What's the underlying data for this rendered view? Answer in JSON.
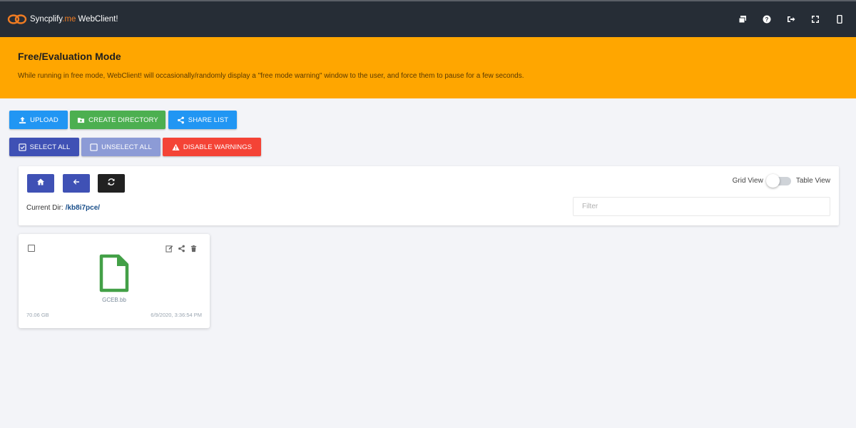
{
  "app": {
    "brand_name": "Syncplify",
    "brand_suffix": ".me",
    "brand_product": " WebClient!",
    "top_icons": [
      "stacked-windows-icon",
      "help-icon",
      "logout-icon",
      "fullscreen-icon",
      "mobile-icon"
    ]
  },
  "banner": {
    "title": "Free/Evaluation Mode",
    "text": "While running in free mode, WebClient! will occasionally/randomly display a \"free mode warning\" window to the user, and force them to pause for a few seconds.",
    "color": "#ffa600"
  },
  "toolbar": {
    "upload_label": "UPLOAD",
    "create_dir_label": "CREATE DIRECTORY",
    "share_list_label": "SHARE LIST",
    "select_all_label": "SELECT ALL",
    "unselect_all_label": "UNSELECT ALL",
    "disable_warnings_label": "DISABLE WARNINGS"
  },
  "colors": {
    "upload": "#2196f3",
    "create_dir": "#4caf50",
    "share": "#2196f3",
    "select_all": "#3f51b5",
    "unselect_all": "#8c9bd6",
    "disable_warnings": "#f44336",
    "home_btn": "#3f51b5",
    "back_btn": "#3f51b5",
    "refresh_btn": "#212121",
    "file_icon": "#43a047"
  },
  "browser": {
    "current_dir_label": "Current Dir:",
    "current_dir": "/kb8i7pce/",
    "grid_view_label": "Grid View",
    "table_view_label": "Table View",
    "view_mode": "grid",
    "filter_placeholder": "Filter"
  },
  "files": [
    {
      "name": "GCEB.bb",
      "size": "70.06 GB",
      "modified": "6/9/2020, 3:36:54 PM",
      "icon": "file-icon"
    }
  ]
}
